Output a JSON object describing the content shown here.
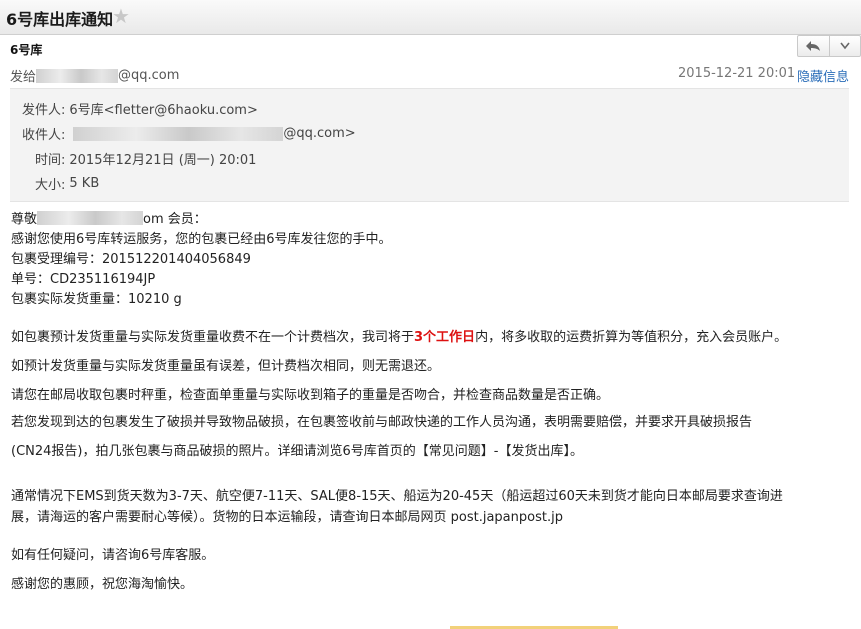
{
  "window": {
    "title": "6号库出库通知",
    "star": "★"
  },
  "header": {
    "sender_name": "6号库",
    "send_to_prefix": "发给",
    "send_to_suffix": "@qq.com",
    "date": "2015-12-21 20:01",
    "hide_info": "隐藏信息",
    "reply_icon": "reply-icon",
    "dropdown_icon": "chevron-down-icon"
  },
  "details": {
    "from_label": "发件人:",
    "from_value": "6号库<fletter@6haoku.com>",
    "to_label": "收件人:",
    "to_suffix": "@qq.com>",
    "time_label": "时间:",
    "time_value": "2015年12月21日 (周一) 20:01",
    "size_label": "大小:",
    "size_value": "5 KB"
  },
  "body": {
    "greeting_prefix": "尊敬",
    "greeting_suffix": "om 会员：",
    "line1": "感谢您使用6号库转运服务，您的包裹已经由6号库发往您的手中。",
    "line2": "包裹受理编号：201512201404056849",
    "line3": "单号：CD235116194JP",
    "line4": "包裹实际发货重量：10210 g",
    "p1_before": "如包裹预计发货重量与实际发货重量收费不在一个计费档次，我司将于",
    "p1_highlight": "3个工作日",
    "p1_after": "内，将多收取的运费折算为等值积分，充入会员账户。",
    "p2": "如预计发货重量与实际发货重量虽有误差，但计费档次相同，则无需退还。",
    "p3": "请您在邮局收取包裹时秤重，检查面单重量与实际收到箱子的重量是否吻合，并检查商品数量是否正确。",
    "p4a": "若您发现到达的包裹发生了破损并导致物品破损，在包裹签收前与邮政快递的工作人员沟通，表明需要赔偿，并要求开具破损报告",
    "p4b": "(CN24报告)，拍几张包裹与商品破损的照片。详细请浏览6号库首页的【常见问题】-【发货出库】。",
    "p5a": "通常情况下EMS到货天数为3-7天、航空便7-11天、SAL便8-15天、船运为20-45天（船运超过60天未到货才能向日本邮局要求查询进",
    "p5b": "展，请海运的客户需要耐心等候）。货物的日本运输段，请查询日本邮局网页 post.japanpost.jp",
    "p6": "如有任何疑问，请咨询6号库客服。",
    "p7": "感谢您的惠顾，祝您海淘愉快。"
  }
}
